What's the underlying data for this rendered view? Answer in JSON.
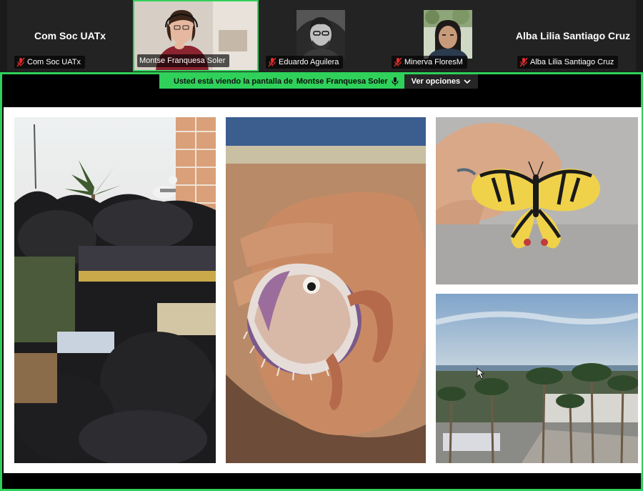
{
  "participants": [
    {
      "name": "Com Soc UATx",
      "label": "Com Soc UATx",
      "muted": true,
      "video": false
    },
    {
      "name": "Montse Franquesa Soler",
      "label": "Montse Franquesa Soler",
      "muted": false,
      "video": true,
      "active_speaker": true
    },
    {
      "name": "Eduardo Aguilera",
      "label": "Eduardo Aguilera",
      "muted": true,
      "video": false
    },
    {
      "name": "Minerva FloresM",
      "label": "Minerva FloresM",
      "muted": true,
      "video": false
    },
    {
      "name": "Alba Lilia Santiago Cruz",
      "label": "Alba Lilia Santiago Cruz",
      "muted": true,
      "video": false
    }
  ],
  "share_banner": {
    "prefix": "Usted está viendo la pantalla de",
    "presenter": "Montse Franquesa Soler",
    "options_label": "Ver opciones"
  },
  "colors": {
    "accent_green": "#2fd15a",
    "muted_red": "#e02b2b",
    "tile_bg": "#232323"
  },
  "icons": [
    "mic-muted-icon",
    "chevron-down-icon",
    "mic-active-icon"
  ],
  "shared_photos": [
    "garbage-bags-photo",
    "argonaut-octopus-photo",
    "swallowtail-butterfly-photo",
    "coastal-palms-photo"
  ]
}
